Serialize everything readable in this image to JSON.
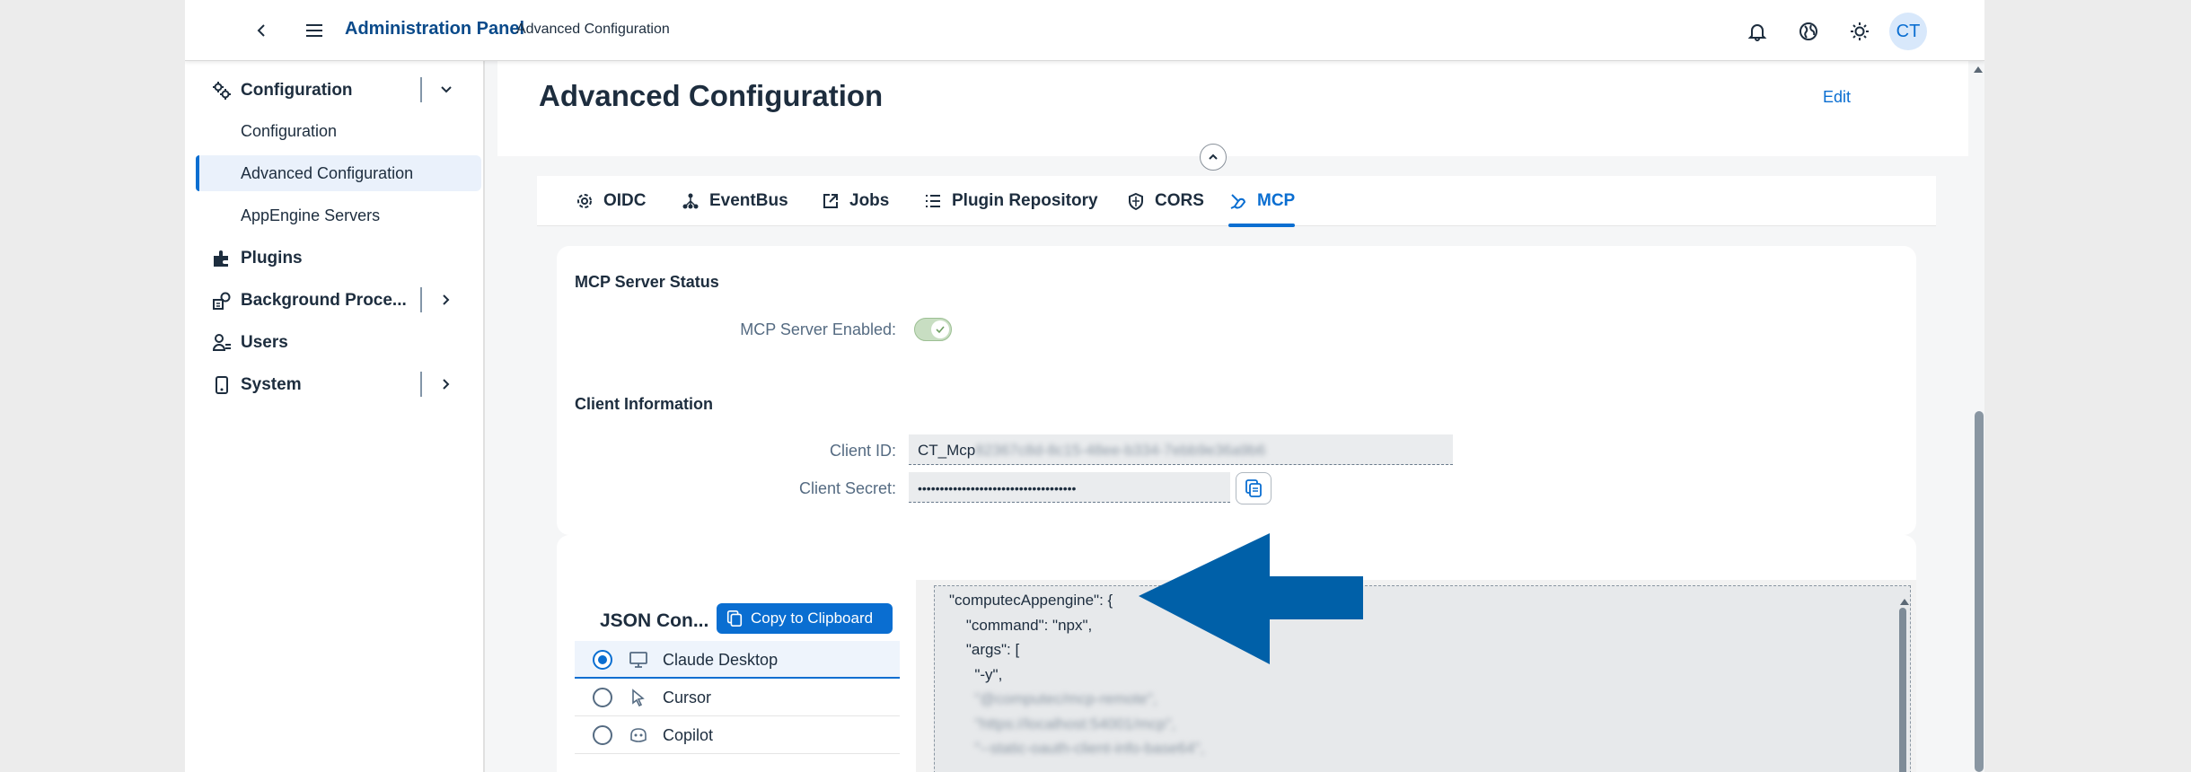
{
  "shell": {
    "title": "Administration Panel",
    "subtitle": "Advanced Configuration",
    "avatar": "CT"
  },
  "sidebar": {
    "groups": [
      {
        "label": "Configuration",
        "icon": "gears-icon",
        "expanded": true
      },
      {
        "label": "Plugins",
        "icon": "plugin-icon"
      },
      {
        "label": "Background Proce...",
        "icon": "background-process-icon"
      },
      {
        "label": "Users",
        "icon": "users-icon"
      },
      {
        "label": "System",
        "icon": "system-icon"
      }
    ],
    "sub_items": [
      "Configuration",
      "Advanced Configuration",
      "AppEngine Servers"
    ],
    "selected": "Advanced Configuration"
  },
  "page": {
    "title": "Advanced Configuration",
    "edit_label": "Edit"
  },
  "tabs": [
    {
      "label": "OIDC",
      "icon": "gear-icon"
    },
    {
      "label": "EventBus",
      "icon": "network-icon"
    },
    {
      "label": "Jobs",
      "icon": "external-link-icon"
    },
    {
      "label": "Plugin Repository",
      "icon": "list-icon"
    },
    {
      "label": "CORS",
      "icon": "shield-icon"
    },
    {
      "label": "MCP",
      "icon": "mcp-icon",
      "active": true
    }
  ],
  "mcp": {
    "status_title": "MCP Server Status",
    "enabled_label": "MCP Server Enabled:",
    "enabled": true,
    "client_title": "Client Information",
    "client_id_label": "Client ID:",
    "client_id_prefix": "CT_Mcp",
    "client_id_rest": "82367c8d-8c15-48ee-b334-7ebb9e36a9b6",
    "client_secret_label": "Client Secret:",
    "client_secret": "••••••••••••••••••••••••••••••••••••"
  },
  "json_config": {
    "title": "JSON Con...",
    "copy_label": "Copy to Clipboard",
    "clients": [
      {
        "label": "Claude Desktop",
        "icon": "desktop-icon",
        "selected": true
      },
      {
        "label": "Cursor",
        "icon": "cursor-icon"
      },
      {
        "label": "Copilot",
        "icon": "copilot-icon"
      }
    ],
    "code_lines": [
      "\"computecAppengine\": {",
      "    \"command\": \"npx\",",
      "    \"args\": [",
      "      \"-y\",",
      "      \"@computec/mcp-remote\",",
      "      \"https://localhost:54001/mcp\",",
      "      \"--static-oauth-client-info-base64\","
    ]
  },
  "colors": {
    "accent": "#0a6ed1",
    "brand": "#0a4a8a",
    "annotation_arrow": "#0060a8"
  }
}
